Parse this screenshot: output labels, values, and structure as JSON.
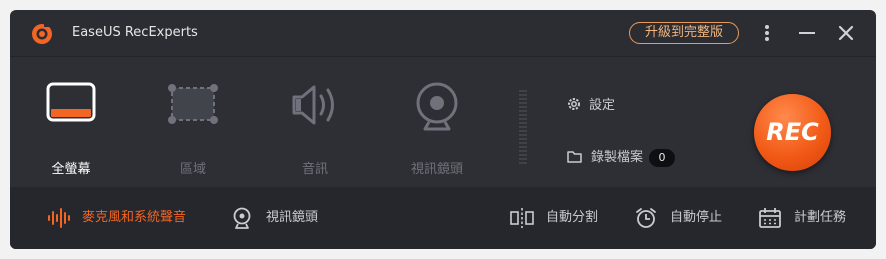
{
  "app": {
    "title": "EaseUS RecExperts",
    "upgrade_label": "升級到完整版"
  },
  "modes": [
    {
      "label": "全螢幕",
      "icon": "fullscreen-icon",
      "active": true
    },
    {
      "label": "區域",
      "icon": "region-icon",
      "active": false
    },
    {
      "label": "音訊",
      "icon": "speaker-icon",
      "active": false
    },
    {
      "label": "視訊鏡頭",
      "icon": "webcam-icon",
      "active": false
    }
  ],
  "settings_label": "設定",
  "recordings": {
    "label": "錄製檔案",
    "count": "0"
  },
  "rec_button_label": "REC",
  "bottom_bar": {
    "audio_source": "麥克風和系統聲音",
    "webcam": "視訊鏡頭",
    "auto_split": "自動分割",
    "auto_stop": "自動停止",
    "schedule": "計劃任務"
  },
  "colors": {
    "accent": "#f26522",
    "background": "#2b2d33",
    "inactive": "#6f727a"
  }
}
